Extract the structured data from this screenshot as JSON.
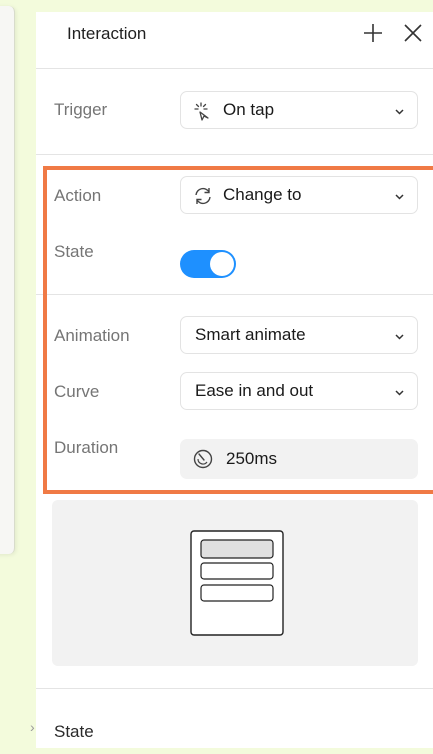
{
  "header": {
    "title": "Interaction"
  },
  "trigger": {
    "label": "Trigger",
    "value": "On tap",
    "icon": "tap-icon"
  },
  "action": {
    "label": "Action",
    "value": "Change to",
    "icon": "refresh-icon"
  },
  "state": {
    "label": "State",
    "toggle_on": true
  },
  "animation": {
    "label": "Animation",
    "value": "Smart animate"
  },
  "curve": {
    "label": "Curve",
    "value": "Ease in and out"
  },
  "duration": {
    "label": "Duration",
    "value": "250ms",
    "icon": "timer-icon"
  },
  "footer": {
    "label": "State"
  },
  "colors": {
    "accent": "#1e90ff",
    "highlight": "#f07a45",
    "background": "#f3fbdc"
  }
}
